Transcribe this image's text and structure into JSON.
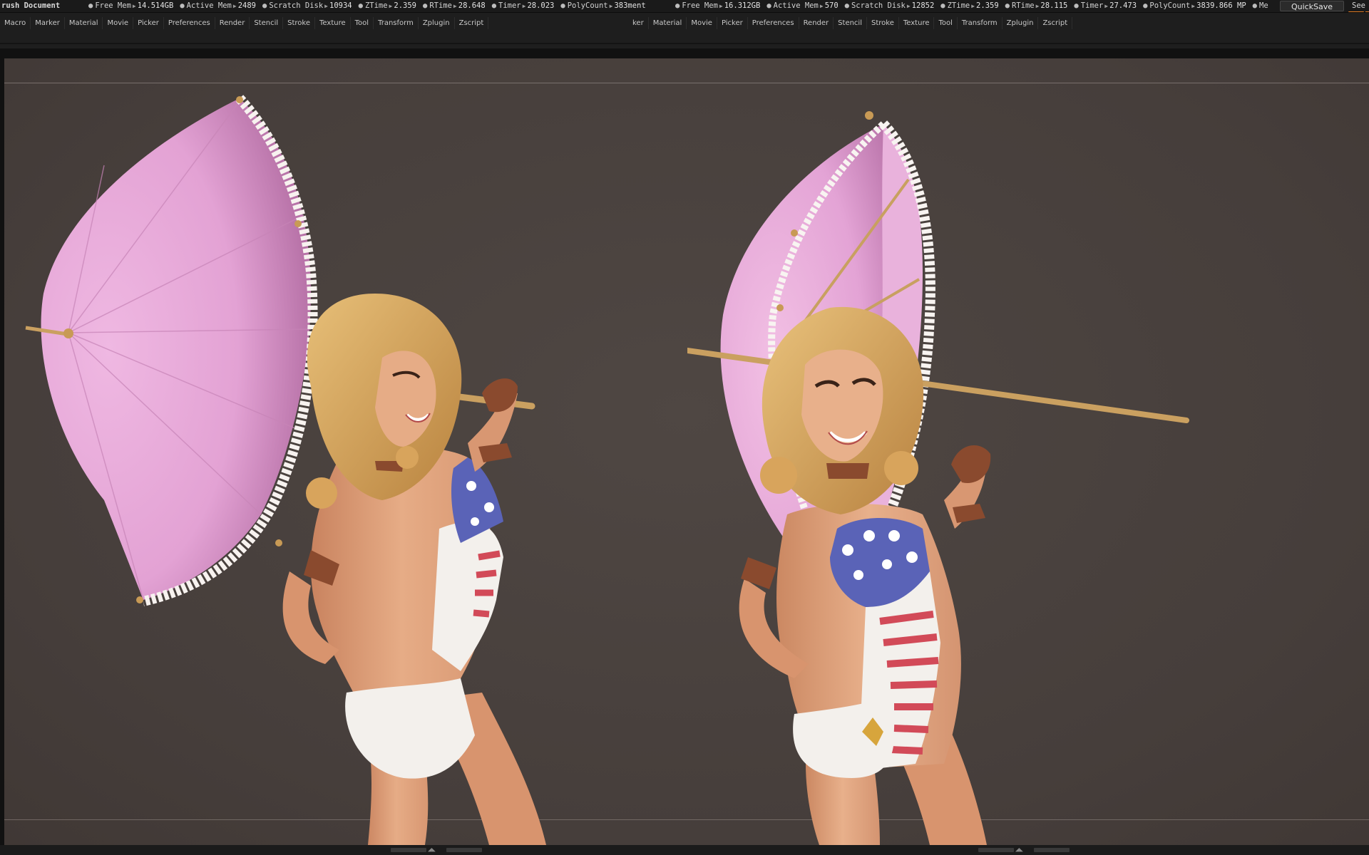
{
  "statusbar": {
    "title": "rush Document",
    "left_stats": [
      {
        "label": "Free Mem",
        "value": "14.514GB"
      },
      {
        "label": "Active Mem",
        "value": "2489"
      },
      {
        "label": "Scratch Disk",
        "value": "10934"
      },
      {
        "label": "ZTime",
        "value": "2.359"
      },
      {
        "label": "RTime",
        "value": "28.648"
      },
      {
        "label": "Timer",
        "value": "28.023"
      },
      {
        "label": "PolyCount",
        "value": "383ment"
      }
    ],
    "right_stats": [
      {
        "label": "Free Mem",
        "value": "16.312GB"
      },
      {
        "label": "Active Mem",
        "value": "570"
      },
      {
        "label": "Scratch Disk",
        "value": "12852"
      },
      {
        "label": "ZTime",
        "value": "2.359"
      },
      {
        "label": "RTime",
        "value": "28.115"
      },
      {
        "label": "Timer",
        "value": "27.473"
      },
      {
        "label": "PolyCount",
        "value": "3839.866 MP"
      },
      {
        "label": "Me",
        "value": ""
      }
    ],
    "quicksave_label": "QuickSave",
    "see_label": "See"
  },
  "menubar": {
    "left_items": [
      "Macro",
      "Marker",
      "Material",
      "Movie",
      "Picker",
      "Preferences",
      "Render",
      "Stencil",
      "Stroke",
      "Texture",
      "Tool",
      "Transform",
      "Zplugin",
      "Zscript"
    ],
    "right_items": [
      "ker",
      "Material",
      "Movie",
      "Picker",
      "Preferences",
      "Render",
      "Stencil",
      "Stroke",
      "Texture",
      "Tool",
      "Transform",
      "Zplugin",
      "Zscript"
    ]
  },
  "colors": {
    "canvas": "#4a423f",
    "umbrella": "#e6a6d6",
    "skin": "#e0a37e",
    "hair": "#d8a45c",
    "suit_white": "#f3f0ec",
    "suit_blue": "#5a63b7",
    "suit_red": "#d24a58",
    "leather": "#8a4a2e",
    "accent": "#e07a22"
  }
}
